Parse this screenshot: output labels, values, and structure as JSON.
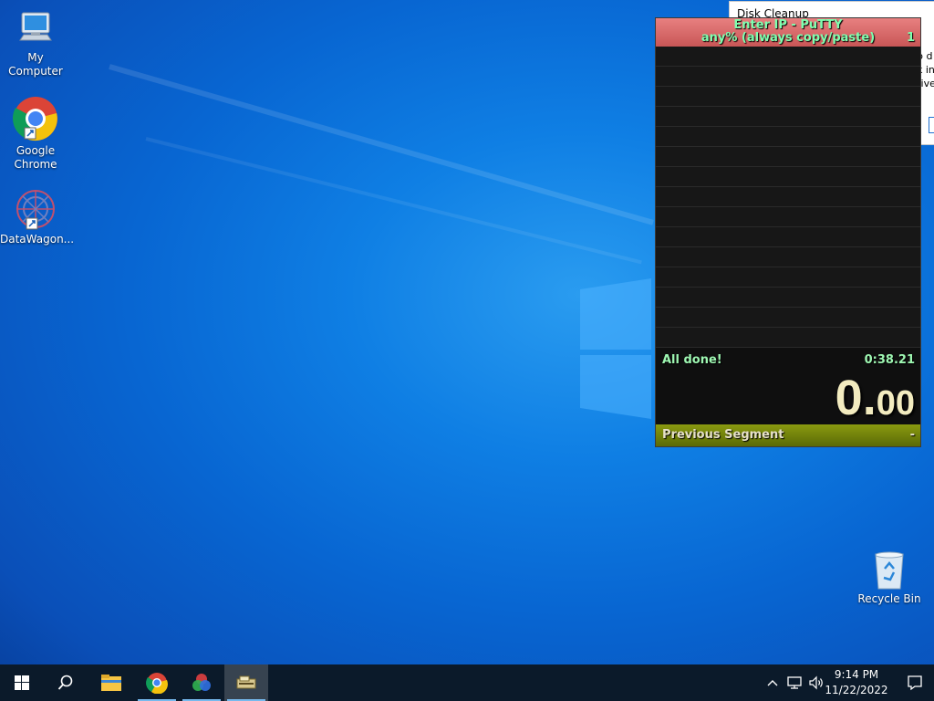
{
  "desktop": {
    "icons": [
      {
        "label": "My Computer"
      },
      {
        "label": "Google Chrome"
      },
      {
        "label": "DataWagon..."
      },
      {
        "label": "Recycle Bin"
      }
    ]
  },
  "disk_cleanup": {
    "title": "Disk Cleanup",
    "side_text": [
      "p d",
      "k in",
      "rive"
    ]
  },
  "livesplit": {
    "game": "Enter IP - PuTTY",
    "category": "any% (always copy/paste)",
    "attempts": "1",
    "status_label": "All done!",
    "segment_time": "0:38.21",
    "timer_main": "0.",
    "timer_decimals": "00",
    "previous_segment_label": "Previous Segment",
    "previous_segment_value": "-",
    "colors": {
      "header": "#d46a6a",
      "text": "#7fffb0",
      "timer": "#f3ecc0",
      "footer": "#7a8a0c"
    }
  },
  "taskbar": {
    "items": [
      "start-icon",
      "search-icon",
      "file-explorer-icon",
      "chrome-icon",
      "datawagon-icon",
      "livesplit-icon"
    ],
    "time": "9:14 PM",
    "date": "11/22/2022"
  }
}
